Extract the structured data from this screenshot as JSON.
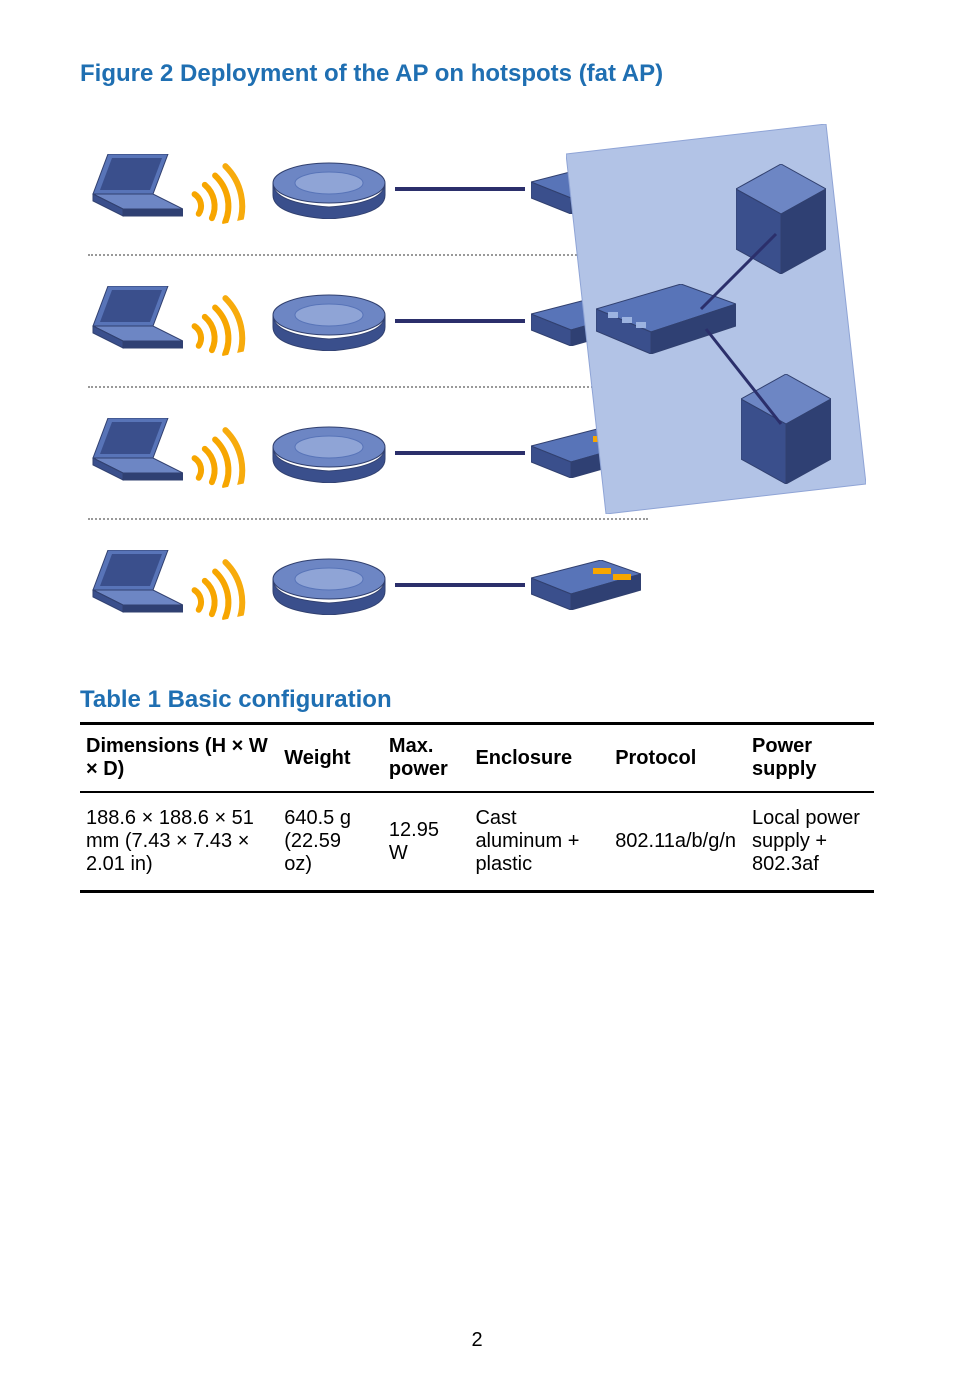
{
  "figure": {
    "caption": "Figure 2 Deployment of the AP on hotspots (fat AP)"
  },
  "table": {
    "caption": "Table 1 Basic configuration",
    "headers": {
      "dimensions": "Dimensions (H × W × D)",
      "weight": "Weight",
      "maxpower": "Max. power",
      "enclosure": "Enclosure",
      "protocol": "Protocol",
      "power": "Power supply"
    },
    "row": {
      "dimensions": "188.6 × 188.6 × 51 mm (7.43 × 7.43 × 2.01 in)",
      "weight": "640.5 g (22.59 oz)",
      "maxpower": "12.95 W",
      "enclosure": "Cast aluminum + plastic",
      "protocol": "802.11a/b/g/n",
      "power": "Local power supply + 802.3af"
    }
  },
  "page_number": "2",
  "icons": {
    "laptop": "laptop-icon",
    "wifi": "wifi-icon",
    "ap": "access-point-icon",
    "switch": "switch-icon",
    "server": "server-icon",
    "panel": "network-panel-icon"
  }
}
